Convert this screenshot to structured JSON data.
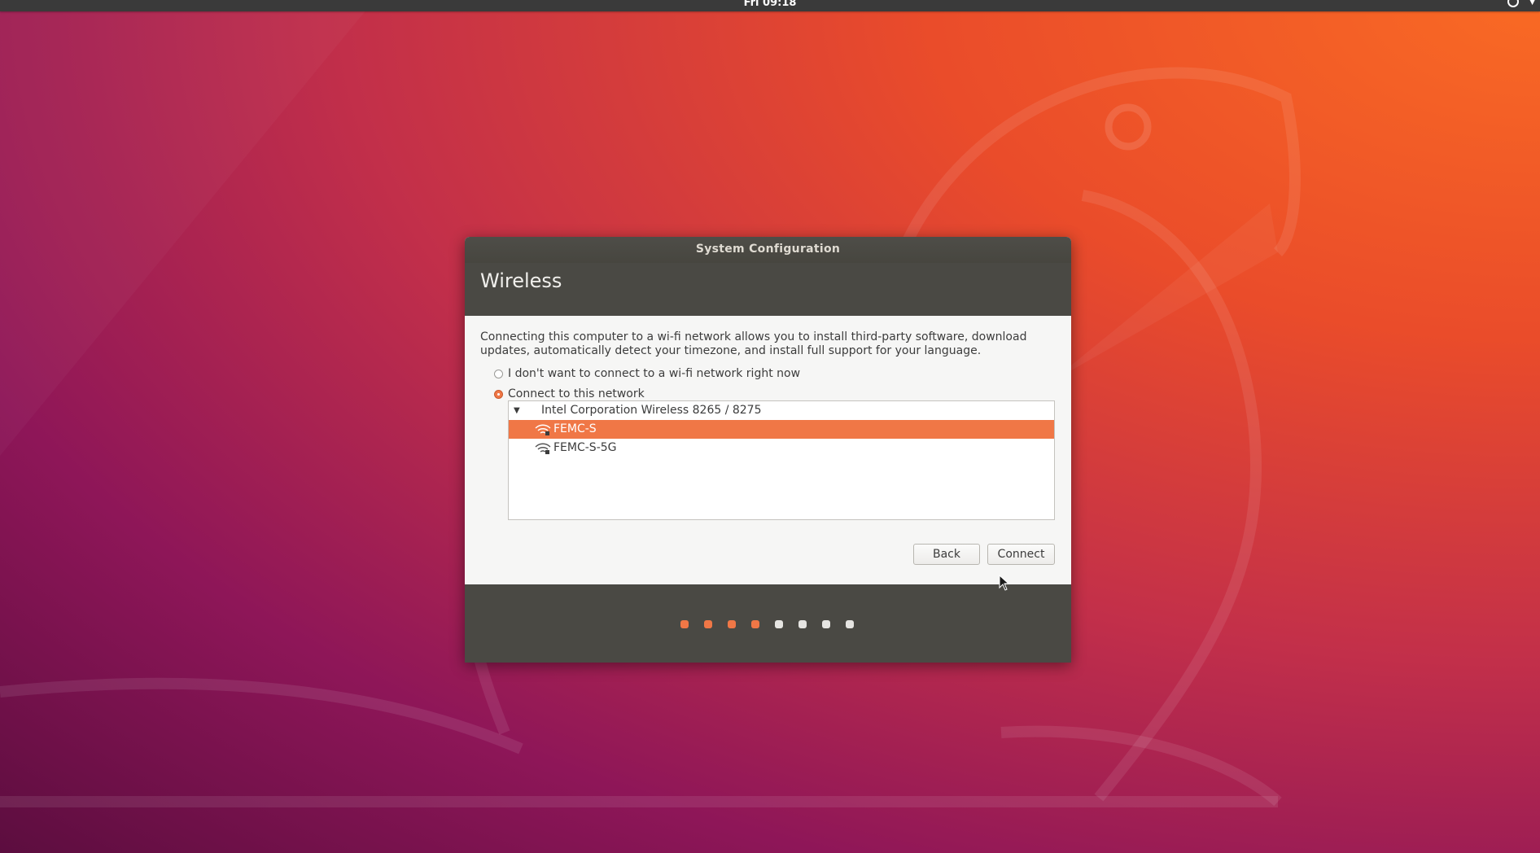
{
  "topbar": {
    "clock": "Fri 09:18"
  },
  "dialog": {
    "window_title": "System Configuration",
    "page_title": "Wireless",
    "description": "Connecting this computer to a wi-fi network allows you to install third-party software, download updates, automatically detect your timezone, and install full support for your language.",
    "options": [
      {
        "label": "I don't want to connect to a wi-fi network right now",
        "selected": false
      },
      {
        "label": "Connect to this network",
        "selected": true
      }
    ],
    "device": "Intel Corporation Wireless 8265 / 8275",
    "networks": [
      {
        "ssid": "FEMC-S",
        "secured": true,
        "selected": true
      },
      {
        "ssid": "FEMC-S-5G",
        "secured": true,
        "selected": false
      }
    ],
    "back_label": "Back",
    "connect_label": "Connect"
  },
  "progress": {
    "total_steps": 8,
    "completed_steps": 4
  },
  "colors": {
    "accent": "#f07746",
    "header_bg": "#4a4944",
    "dialog_bg": "#f6f6f5"
  }
}
